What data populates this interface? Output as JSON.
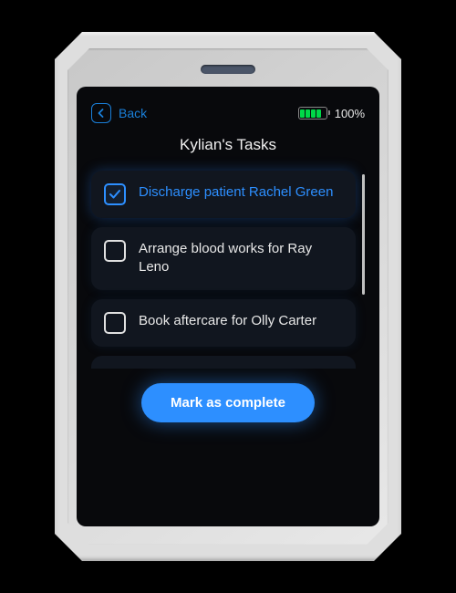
{
  "header": {
    "back_label": "Back",
    "battery_percent": "100%"
  },
  "page_title": "Kylian's Tasks",
  "tasks": [
    {
      "label": "Discharge patient Rachel Green",
      "checked": true
    },
    {
      "label": "Arrange blood works for Ray Leno",
      "checked": false
    },
    {
      "label": "Book aftercare for Olly Carter",
      "checked": false
    }
  ],
  "complete_button_label": "Mark as complete",
  "colors": {
    "accent": "#2d8fff",
    "battery_fill": "#00d948"
  }
}
